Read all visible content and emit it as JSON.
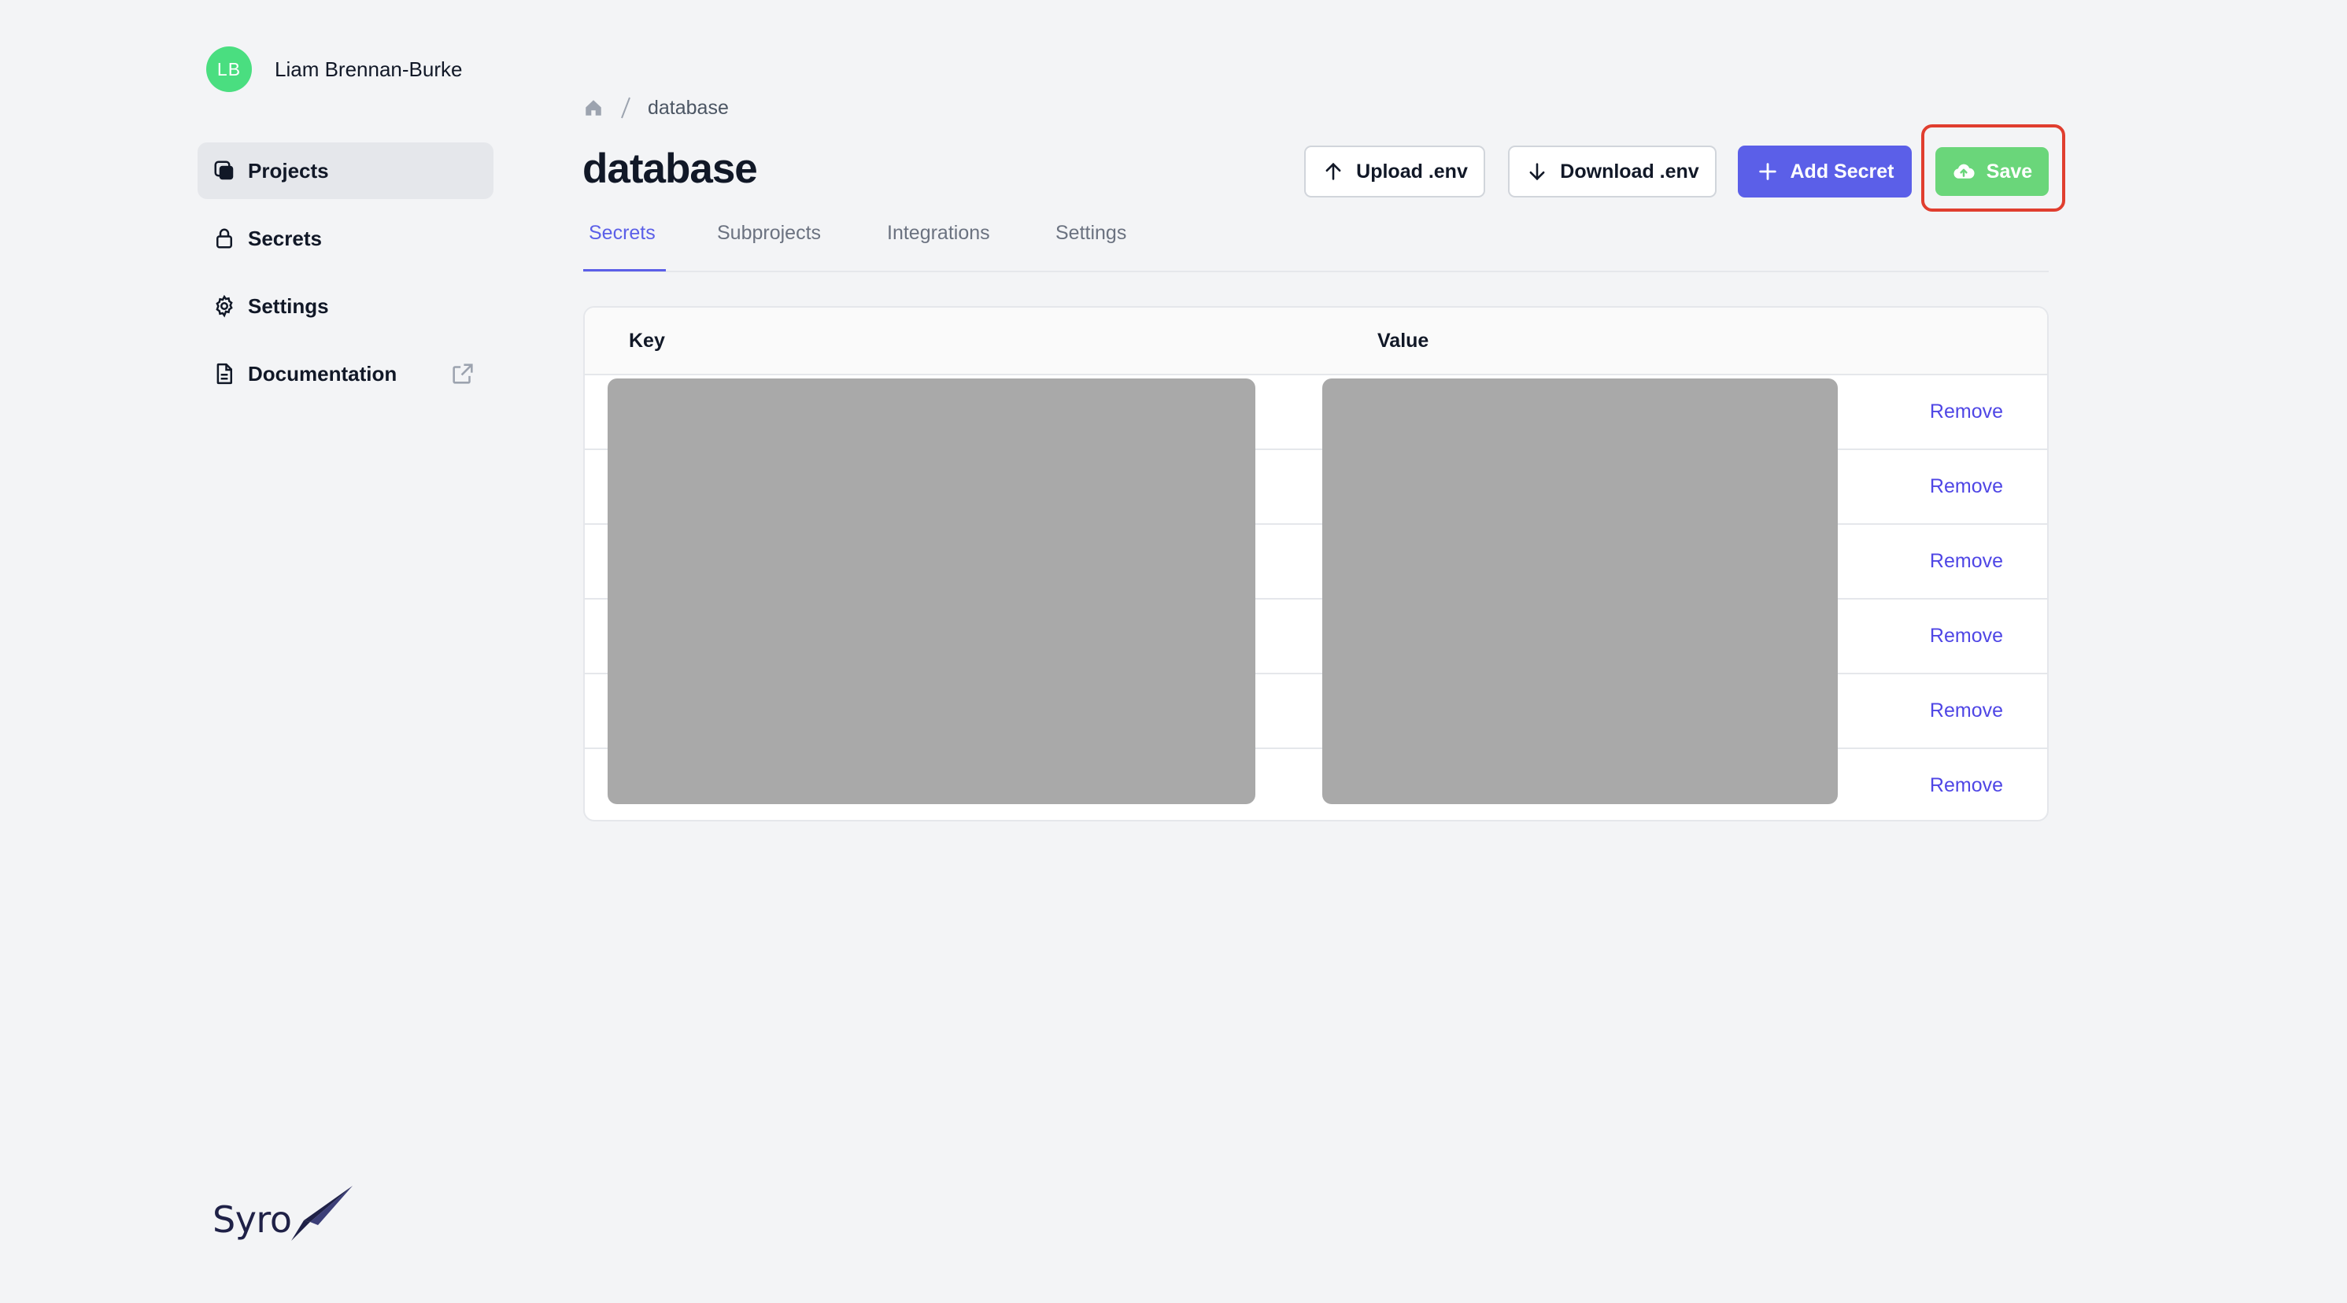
{
  "user": {
    "initials": "LB",
    "name": "Liam Brennan-Burke",
    "avatar_color": "#4ade80"
  },
  "sidebar": {
    "items": [
      {
        "label": "Projects",
        "icon": "projects-icon",
        "active": true
      },
      {
        "label": "Secrets",
        "icon": "lock-icon",
        "active": false
      },
      {
        "label": "Settings",
        "icon": "gear-icon",
        "active": false
      },
      {
        "label": "Documentation",
        "icon": "document-icon",
        "active": false,
        "external": true
      }
    ]
  },
  "logo": {
    "text": "Syro"
  },
  "breadcrumb": {
    "home_icon": "home-icon",
    "current": "database"
  },
  "page": {
    "title": "database"
  },
  "toolbar": {
    "upload_label": "Upload .env",
    "download_label": "Download .env",
    "add_label": "Add Secret",
    "save_label": "Save"
  },
  "tabs": [
    {
      "label": "Secrets",
      "active": true
    },
    {
      "label": "Subprojects",
      "active": false
    },
    {
      "label": "Integrations",
      "active": false
    },
    {
      "label": "Settings",
      "active": false
    }
  ],
  "table": {
    "headers": {
      "key": "Key",
      "value": "Value"
    },
    "rows": [
      {
        "action": "Remove"
      },
      {
        "action": "Remove"
      },
      {
        "action": "Remove"
      },
      {
        "action": "Remove"
      },
      {
        "action": "Remove"
      },
      {
        "action": "Remove"
      }
    ]
  },
  "colors": {
    "accent": "#5b5fe8",
    "save": "#6ad67a",
    "highlight": "#e03e2f",
    "link": "#4f46e5"
  }
}
